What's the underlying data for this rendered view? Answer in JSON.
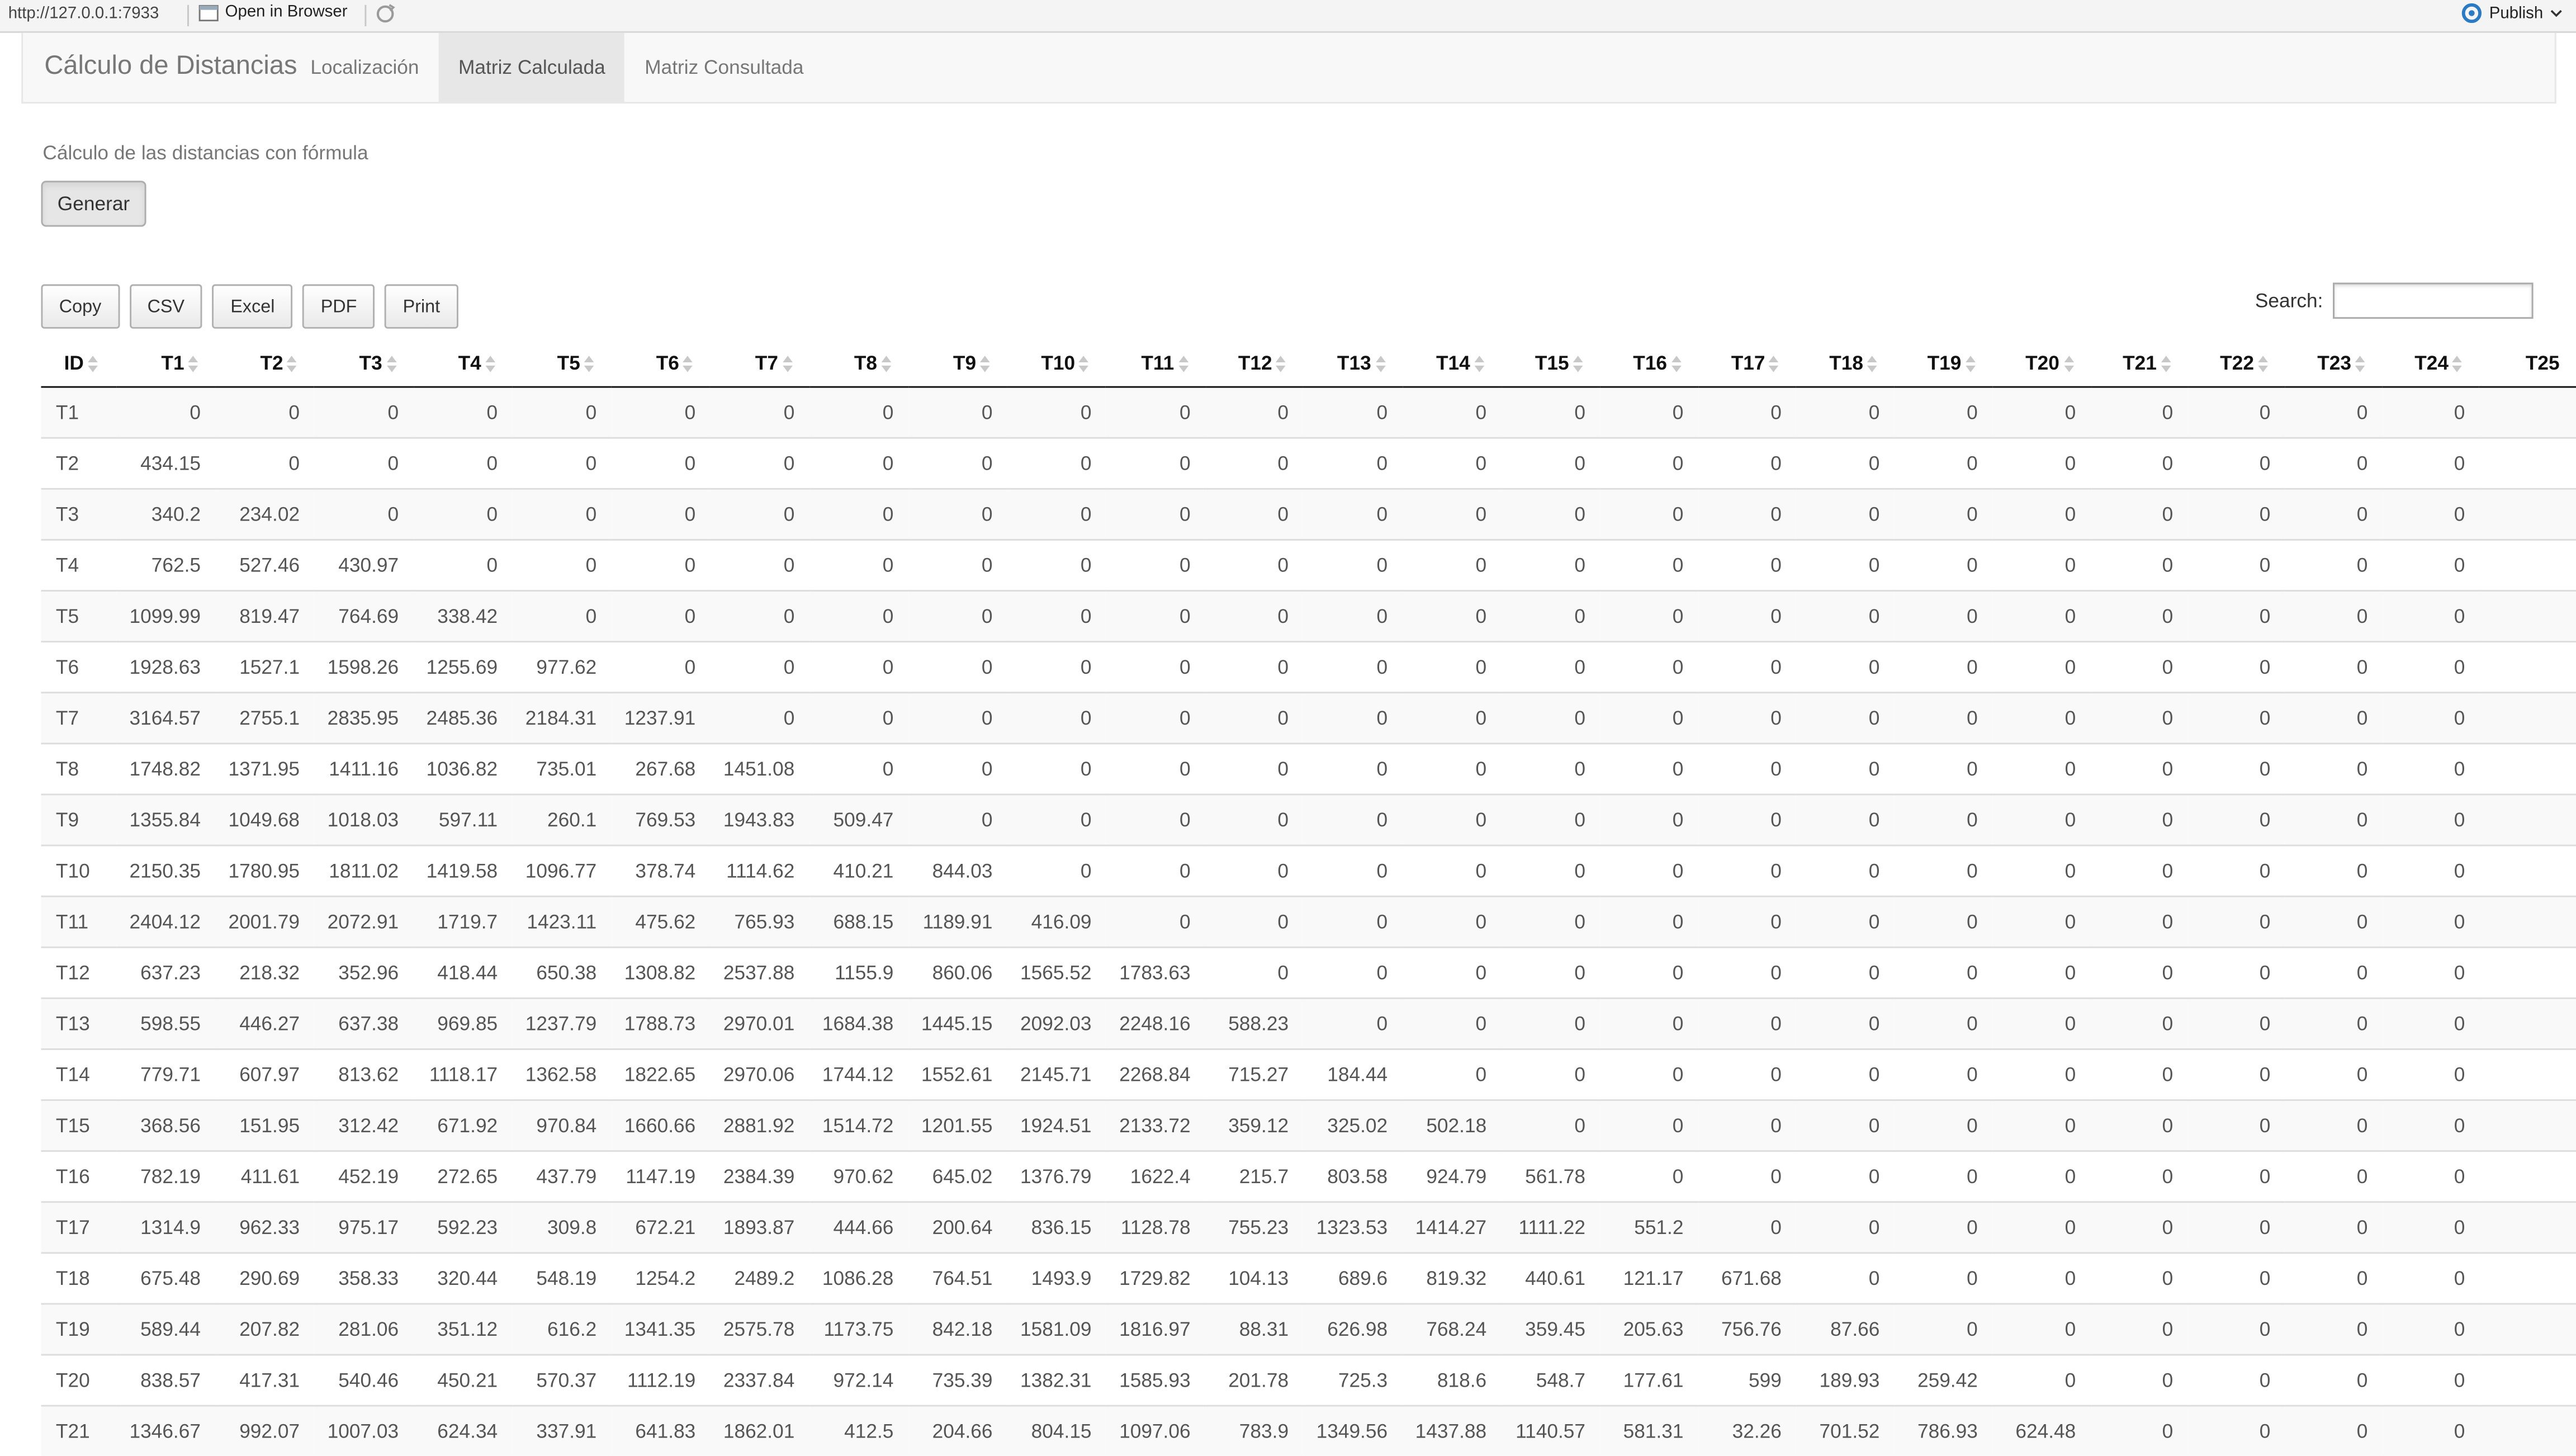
{
  "topbar": {
    "url": "http://127.0.0.1:7933",
    "open_label": "Open in Browser",
    "publish_label": "Publish"
  },
  "navbar": {
    "brand": "Cálculo de Distancias",
    "tabs": [
      {
        "label": "Localización",
        "active": false
      },
      {
        "label": "Matriz Calculada",
        "active": true
      },
      {
        "label": "Matriz Consultada",
        "active": false
      }
    ]
  },
  "main": {
    "subtitle": "Cálculo de las distancias con fórmula",
    "generate_label": "Generar",
    "table_buttons": [
      "Copy",
      "CSV",
      "Excel",
      "PDF",
      "Print"
    ],
    "search_label": "Search:",
    "search_value": ""
  },
  "table": {
    "headers": [
      "ID",
      "T1",
      "T2",
      "T3",
      "T4",
      "T5",
      "T6",
      "T7",
      "T8",
      "T9",
      "T10",
      "T11",
      "T12",
      "T13",
      "T14",
      "T15",
      "T16",
      "T17",
      "T18",
      "T19",
      "T20",
      "T21",
      "T22",
      "T23",
      "T24",
      "T25"
    ],
    "rows": [
      [
        "T1",
        "0",
        "0",
        "0",
        "0",
        "0",
        "0",
        "0",
        "0",
        "0",
        "0",
        "0",
        "0",
        "0",
        "0",
        "0",
        "0",
        "0",
        "0",
        "0",
        "0",
        "0",
        "0",
        "0",
        "0",
        ""
      ],
      [
        "T2",
        "434.15",
        "0",
        "0",
        "0",
        "0",
        "0",
        "0",
        "0",
        "0",
        "0",
        "0",
        "0",
        "0",
        "0",
        "0",
        "0",
        "0",
        "0",
        "0",
        "0",
        "0",
        "0",
        "0",
        "0",
        ""
      ],
      [
        "T3",
        "340.2",
        "234.02",
        "0",
        "0",
        "0",
        "0",
        "0",
        "0",
        "0",
        "0",
        "0",
        "0",
        "0",
        "0",
        "0",
        "0",
        "0",
        "0",
        "0",
        "0",
        "0",
        "0",
        "0",
        "0",
        ""
      ],
      [
        "T4",
        "762.5",
        "527.46",
        "430.97",
        "0",
        "0",
        "0",
        "0",
        "0",
        "0",
        "0",
        "0",
        "0",
        "0",
        "0",
        "0",
        "0",
        "0",
        "0",
        "0",
        "0",
        "0",
        "0",
        "0",
        "0",
        ""
      ],
      [
        "T5",
        "1099.99",
        "819.47",
        "764.69",
        "338.42",
        "0",
        "0",
        "0",
        "0",
        "0",
        "0",
        "0",
        "0",
        "0",
        "0",
        "0",
        "0",
        "0",
        "0",
        "0",
        "0",
        "0",
        "0",
        "0",
        "0",
        ""
      ],
      [
        "T6",
        "1928.63",
        "1527.1",
        "1598.26",
        "1255.69",
        "977.62",
        "0",
        "0",
        "0",
        "0",
        "0",
        "0",
        "0",
        "0",
        "0",
        "0",
        "0",
        "0",
        "0",
        "0",
        "0",
        "0",
        "0",
        "0",
        "0",
        ""
      ],
      [
        "T7",
        "3164.57",
        "2755.1",
        "2835.95",
        "2485.36",
        "2184.31",
        "1237.91",
        "0",
        "0",
        "0",
        "0",
        "0",
        "0",
        "0",
        "0",
        "0",
        "0",
        "0",
        "0",
        "0",
        "0",
        "0",
        "0",
        "0",
        "0",
        ""
      ],
      [
        "T8",
        "1748.82",
        "1371.95",
        "1411.16",
        "1036.82",
        "735.01",
        "267.68",
        "1451.08",
        "0",
        "0",
        "0",
        "0",
        "0",
        "0",
        "0",
        "0",
        "0",
        "0",
        "0",
        "0",
        "0",
        "0",
        "0",
        "0",
        "0",
        ""
      ],
      [
        "T9",
        "1355.84",
        "1049.68",
        "1018.03",
        "597.11",
        "260.1",
        "769.53",
        "1943.83",
        "509.47",
        "0",
        "0",
        "0",
        "0",
        "0",
        "0",
        "0",
        "0",
        "0",
        "0",
        "0",
        "0",
        "0",
        "0",
        "0",
        "0",
        ""
      ],
      [
        "T10",
        "2150.35",
        "1780.95",
        "1811.02",
        "1419.58",
        "1096.77",
        "378.74",
        "1114.62",
        "410.21",
        "844.03",
        "0",
        "0",
        "0",
        "0",
        "0",
        "0",
        "0",
        "0",
        "0",
        "0",
        "0",
        "0",
        "0",
        "0",
        "0",
        ""
      ],
      [
        "T11",
        "2404.12",
        "2001.79",
        "2072.91",
        "1719.7",
        "1423.11",
        "475.62",
        "765.93",
        "688.15",
        "1189.91",
        "416.09",
        "0",
        "0",
        "0",
        "0",
        "0",
        "0",
        "0",
        "0",
        "0",
        "0",
        "0",
        "0",
        "0",
        "0",
        ""
      ],
      [
        "T12",
        "637.23",
        "218.32",
        "352.96",
        "418.44",
        "650.38",
        "1308.82",
        "2537.88",
        "1155.9",
        "860.06",
        "1565.52",
        "1783.63",
        "0",
        "0",
        "0",
        "0",
        "0",
        "0",
        "0",
        "0",
        "0",
        "0",
        "0",
        "0",
        "0",
        ""
      ],
      [
        "T13",
        "598.55",
        "446.27",
        "637.38",
        "969.85",
        "1237.79",
        "1788.73",
        "2970.01",
        "1684.38",
        "1445.15",
        "2092.03",
        "2248.16",
        "588.23",
        "0",
        "0",
        "0",
        "0",
        "0",
        "0",
        "0",
        "0",
        "0",
        "0",
        "0",
        "0",
        ""
      ],
      [
        "T14",
        "779.71",
        "607.97",
        "813.62",
        "1118.17",
        "1362.58",
        "1822.65",
        "2970.06",
        "1744.12",
        "1552.61",
        "2145.71",
        "2268.84",
        "715.27",
        "184.44",
        "0",
        "0",
        "0",
        "0",
        "0",
        "0",
        "0",
        "0",
        "0",
        "0",
        "0",
        ""
      ],
      [
        "T15",
        "368.56",
        "151.95",
        "312.42",
        "671.92",
        "970.84",
        "1660.66",
        "2881.92",
        "1514.72",
        "1201.55",
        "1924.51",
        "2133.72",
        "359.12",
        "325.02",
        "502.18",
        "0",
        "0",
        "0",
        "0",
        "0",
        "0",
        "0",
        "0",
        "0",
        "0",
        ""
      ],
      [
        "T16",
        "782.19",
        "411.61",
        "452.19",
        "272.65",
        "437.79",
        "1147.19",
        "2384.39",
        "970.62",
        "645.02",
        "1376.79",
        "1622.4",
        "215.7",
        "803.58",
        "924.79",
        "561.78",
        "0",
        "0",
        "0",
        "0",
        "0",
        "0",
        "0",
        "0",
        "0",
        ""
      ],
      [
        "T17",
        "1314.9",
        "962.33",
        "975.17",
        "592.23",
        "309.8",
        "672.21",
        "1893.87",
        "444.66",
        "200.64",
        "836.15",
        "1128.78",
        "755.23",
        "1323.53",
        "1414.27",
        "1111.22",
        "551.2",
        "0",
        "0",
        "0",
        "0",
        "0",
        "0",
        "0",
        "0",
        ""
      ],
      [
        "T18",
        "675.48",
        "290.69",
        "358.33",
        "320.44",
        "548.19",
        "1254.2",
        "2489.2",
        "1086.28",
        "764.51",
        "1493.9",
        "1729.82",
        "104.13",
        "689.6",
        "819.32",
        "440.61",
        "121.17",
        "671.68",
        "0",
        "0",
        "0",
        "0",
        "0",
        "0",
        "0",
        ""
      ],
      [
        "T19",
        "589.44",
        "207.82",
        "281.06",
        "351.12",
        "616.2",
        "1341.35",
        "2575.78",
        "1173.75",
        "842.18",
        "1581.09",
        "1816.97",
        "88.31",
        "626.98",
        "768.24",
        "359.45",
        "205.63",
        "756.76",
        "87.66",
        "0",
        "0",
        "0",
        "0",
        "0",
        "0",
        ""
      ],
      [
        "T20",
        "838.57",
        "417.31",
        "540.46",
        "450.21",
        "570.37",
        "1112.19",
        "2337.84",
        "972.14",
        "735.39",
        "1382.31",
        "1585.93",
        "201.78",
        "725.3",
        "818.6",
        "548.7",
        "177.61",
        "599",
        "189.93",
        "259.42",
        "0",
        "0",
        "0",
        "0",
        "0",
        ""
      ],
      [
        "T21",
        "1346.67",
        "992.07",
        "1007.03",
        "624.34",
        "337.91",
        "641.83",
        "1862.01",
        "412.5",
        "204.66",
        "804.15",
        "1097.06",
        "783.9",
        "1349.56",
        "1437.88",
        "1140.57",
        "581.31",
        "32.26",
        "701.52",
        "786.93",
        "624.48",
        "0",
        "0",
        "0",
        "0",
        ""
      ]
    ]
  }
}
